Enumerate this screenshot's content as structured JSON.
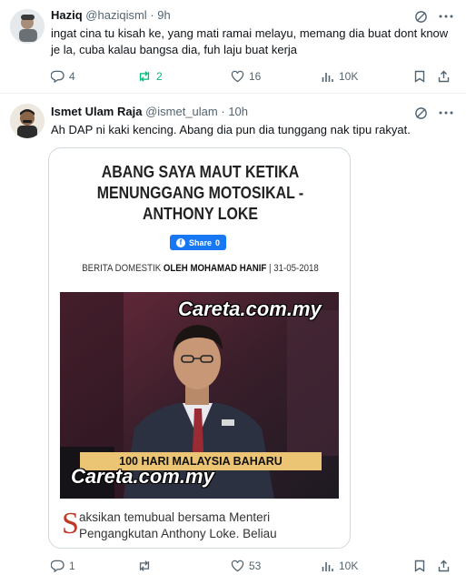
{
  "tweets": [
    {
      "user": {
        "name": "Haziq",
        "handle": "@haziqisml"
      },
      "separator": "·",
      "time": "9h",
      "text": "ingat cina tu kisah ke, yang mati ramai melayu, memang dia buat dont know je la, cuba kalau bangsa dia, fuh laju buat kerja",
      "actions": {
        "replies": "4",
        "reposts": "2",
        "likes": "16",
        "views": "10K"
      },
      "repost_color": "#00ba7c"
    },
    {
      "user": {
        "name": "Ismet Ulam Raja",
        "handle": "@ismet_ulam"
      },
      "separator": "·",
      "time": "10h",
      "text": "Ah DAP ni kaki kencing. Abang dia pun dia tunggang nak tipu rakyat.",
      "card": {
        "headline": "ABANG SAYA MAUT KETIKA MENUNGGANG MOTOSIKAL - ANTHONY LOKE",
        "share_label": "Share",
        "share_count": "0",
        "byline_section": "BERITA DOMESTIK",
        "byline_author": "OLEH MOHAMAD HANIF",
        "byline_sep": "|",
        "byline_date": "31-05-2018",
        "watermark": "Careta.com.my",
        "lower_third": "100 HARI MALAYSIA BAHARU",
        "caption_dropcap": "S",
        "caption_line1": "aksikan temubual bersama Menteri",
        "caption_line2": "Pengangkutan Anthony Loke. Beliau"
      },
      "actions": {
        "replies": "1",
        "reposts": "",
        "likes": "53",
        "views": "10K"
      }
    }
  ],
  "icons": [
    "grok-icon",
    "more-icon",
    "reply-icon",
    "repost-icon",
    "like-icon",
    "views-icon",
    "bookmark-icon",
    "share-icon"
  ],
  "colors": {
    "text": "#0f1419",
    "muted": "#536471",
    "border": "#eff3f4",
    "repost_active": "#00ba7c",
    "fb_blue": "#1877f2"
  }
}
